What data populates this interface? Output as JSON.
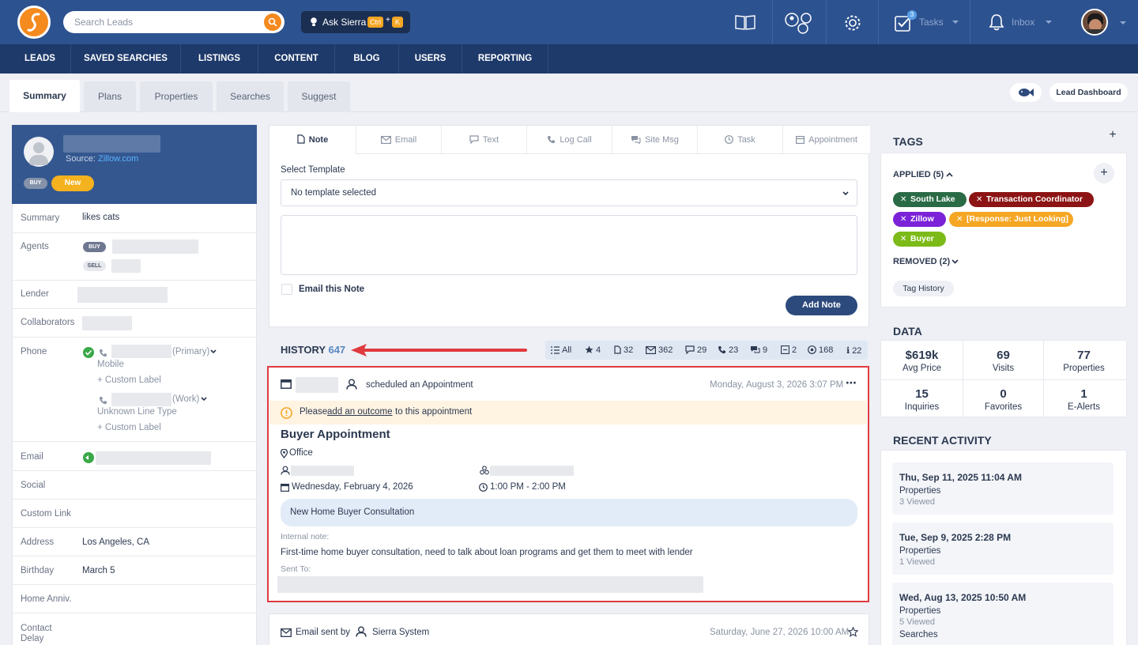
{
  "header": {
    "search_placeholder": "Search Leads",
    "ask_label": "Ask Sierra",
    "kbd_ctrl": "Ctrl",
    "kbd_plus": "+",
    "kbd_k": "K",
    "tasks_label": "Tasks",
    "tasks_count": "3",
    "inbox_label": "Inbox"
  },
  "nav": [
    "LEADS",
    "SAVED SEARCHES",
    "LISTINGS",
    "CONTENT",
    "BLOG",
    "USERS",
    "REPORTING"
  ],
  "tabs": {
    "summary": "Summary",
    "plans": "Plans",
    "properties": "Properties",
    "searches": "Searches",
    "suggest": "Suggest",
    "lead_dashboard": "Lead Dashboard"
  },
  "lead": {
    "source_label": "Source:",
    "source_value": "Zillow.com",
    "type_badge": "BUY",
    "status_badge": "New",
    "fields": {
      "summary_k": "Summary",
      "summary_v": "likes cats",
      "agents_k": "Agents",
      "agent_buy": "BUY",
      "agent_sell": "SELL",
      "lender_k": "Lender",
      "collab_k": "Collaborators",
      "phone_k": "Phone",
      "phone1_type": "(Primary)",
      "phone1_label": "Mobile",
      "custom_label": "+ Custom Label",
      "phone2_type": "(Work)",
      "phone2_label": "Unknown Line Type",
      "custom_label2": "+ Custom Label",
      "email_k": "Email",
      "social_k": "Social",
      "customlink_k": "Custom Link",
      "address_k": "Address",
      "address_v": "Los Angeles, CA",
      "birthday_k": "Birthday",
      "birthday_v": "March 5",
      "homeanniv_k": "Home Anniv.",
      "contact_k": "Contact",
      "delay_k": "Delay"
    }
  },
  "compose": {
    "tabs": {
      "note": "Note",
      "email": "Email",
      "text": "Text",
      "logcall": "Log Call",
      "sitemsg": "Site Msg",
      "task": "Task",
      "appointment": "Appointment"
    },
    "template_label": "Select Template",
    "template_value": "No template selected",
    "email_note": "Email this Note",
    "add_note": "Add Note"
  },
  "history": {
    "label": "HISTORY",
    "count": "647",
    "filters": {
      "all": "All",
      "star": "4",
      "doc": "32",
      "email": "362",
      "chat": "29",
      "call": "23",
      "msg": "9",
      "task": "2",
      "visit": "168",
      "info": "22"
    }
  },
  "appointment": {
    "action": "scheduled an Appointment",
    "time": "Monday, August 3, 2026 3:07 PM",
    "alert_pre": "Please",
    "alert_link": "add an outcome",
    "alert_post": "to this appointment",
    "title": "Buyer Appointment",
    "location": "Office",
    "date": "Wednesday, February 4, 2026",
    "hours": "1:00 PM - 2:00 PM",
    "subject": "New Home Buyer Consultation",
    "note_label": "Internal note:",
    "note": "First-time home buyer consultation, need to talk about loan programs and get them to meet with lender",
    "sent_label": "Sent To:"
  },
  "email_entry": {
    "label": "Email sent by",
    "sender": "Sierra System",
    "time": "Saturday, June 27, 2026 10:00 AM"
  },
  "tags": {
    "title": "TAGS",
    "applied": "APPLIED (5)",
    "removed": "REMOVED (2)",
    "history": "Tag History",
    "items": [
      {
        "label": "South Lake",
        "color": "#2a6b45"
      },
      {
        "label": "Transaction Coordinator",
        "color": "#8c1414"
      },
      {
        "label": "Zillow",
        "color": "#7b22d8"
      },
      {
        "label": "[Response: Just Looking]",
        "color": "#f5a623"
      },
      {
        "label": "Buyer",
        "color": "#7cba18"
      }
    ]
  },
  "data": {
    "title": "DATA",
    "stats": [
      {
        "n": "$619k",
        "l": "Avg Price"
      },
      {
        "n": "69",
        "l": "Visits"
      },
      {
        "n": "77",
        "l": "Properties"
      },
      {
        "n": "15",
        "l": "Inquiries"
      },
      {
        "n": "0",
        "l": "Favorites"
      },
      {
        "n": "1",
        "l": "E-Alerts"
      }
    ]
  },
  "recent": {
    "title": "RECENT ACTIVITY",
    "items": [
      {
        "date": "Thu, Sep 11, 2025 11:04 AM",
        "type": "Properties",
        "detail": "3 Viewed"
      },
      {
        "date": "Tue, Sep 9, 2025 2:28 PM",
        "type": "Properties",
        "detail": "1 Viewed"
      },
      {
        "date": "Wed, Aug 13, 2025 10:50 AM",
        "type": "Properties",
        "detail": "5 Viewed",
        "extra": "Searches"
      }
    ]
  }
}
